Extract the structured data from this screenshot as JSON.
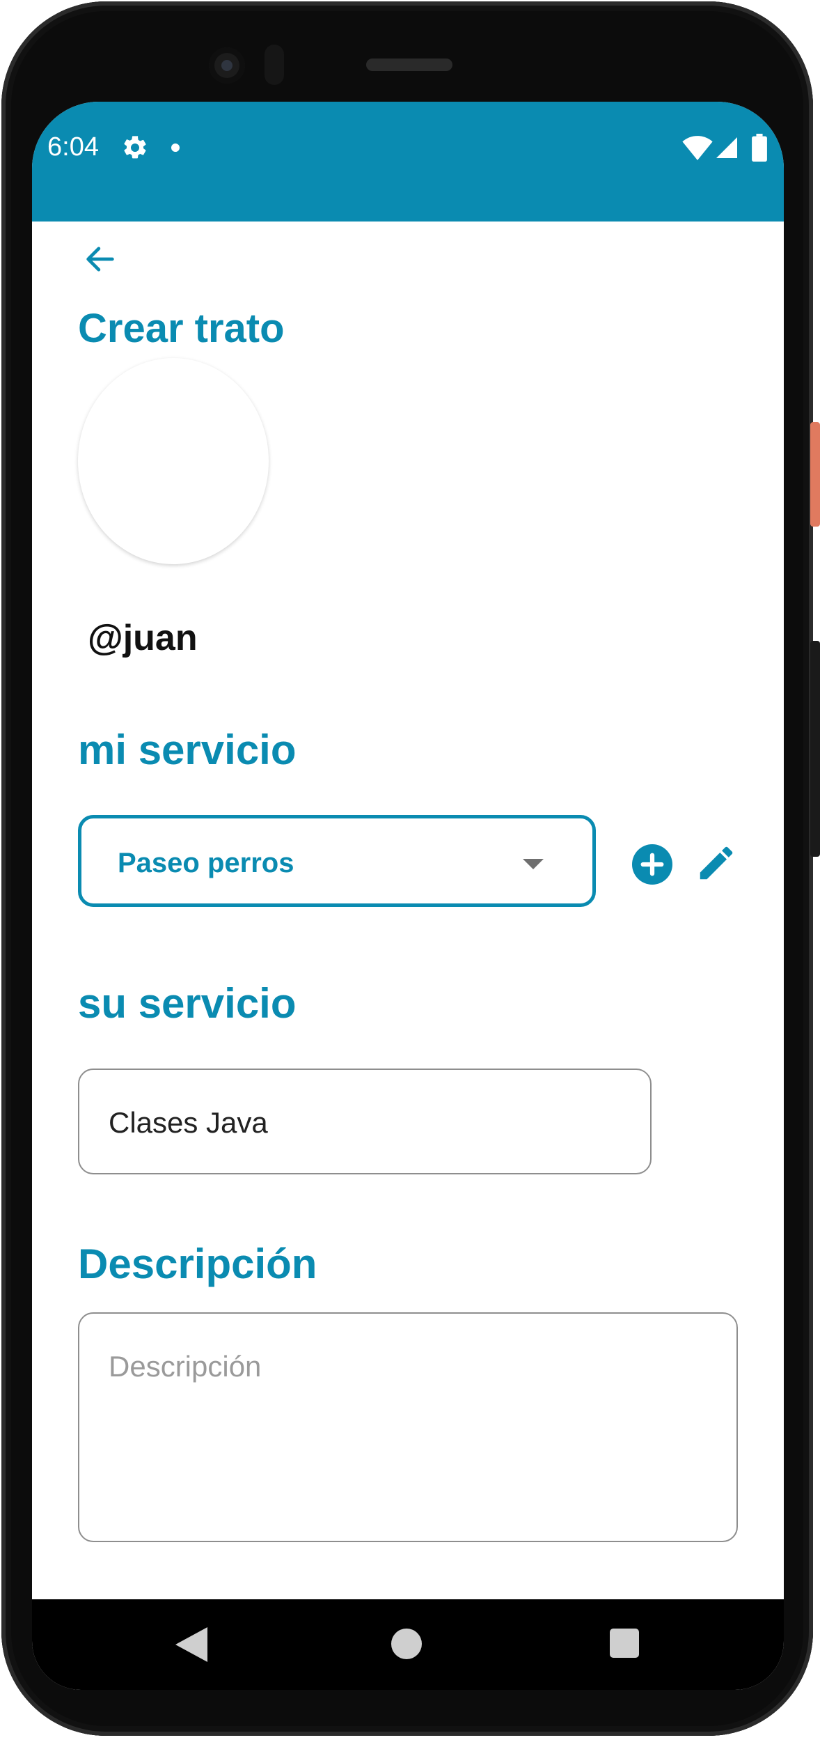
{
  "status_bar": {
    "time": "6:04",
    "icons": [
      "gear-icon",
      "notification-dot",
      "wifi-icon",
      "signal-icon",
      "battery-icon"
    ],
    "color": "#0a8bb1"
  },
  "header": {
    "back_icon": "arrow-left-icon",
    "title": "Crear trato"
  },
  "profile": {
    "username": "@juan"
  },
  "mi_servicio": {
    "label": "mi servicio",
    "selected": "Paseo perros",
    "add_icon": "plus-circle-icon",
    "edit_icon": "pencil-icon"
  },
  "su_servicio": {
    "label": "su servicio",
    "value": "Clases Java"
  },
  "descripcion": {
    "label": "Descripción",
    "placeholder": "Descripción",
    "value": ""
  },
  "nav_bar": {
    "icons": [
      "back-triangle-icon",
      "home-circle-icon",
      "recents-square-icon"
    ]
  },
  "colors": {
    "accent": "#0a8bb1",
    "border": "#8e8e8e",
    "placeholder": "#9a9a9a"
  }
}
